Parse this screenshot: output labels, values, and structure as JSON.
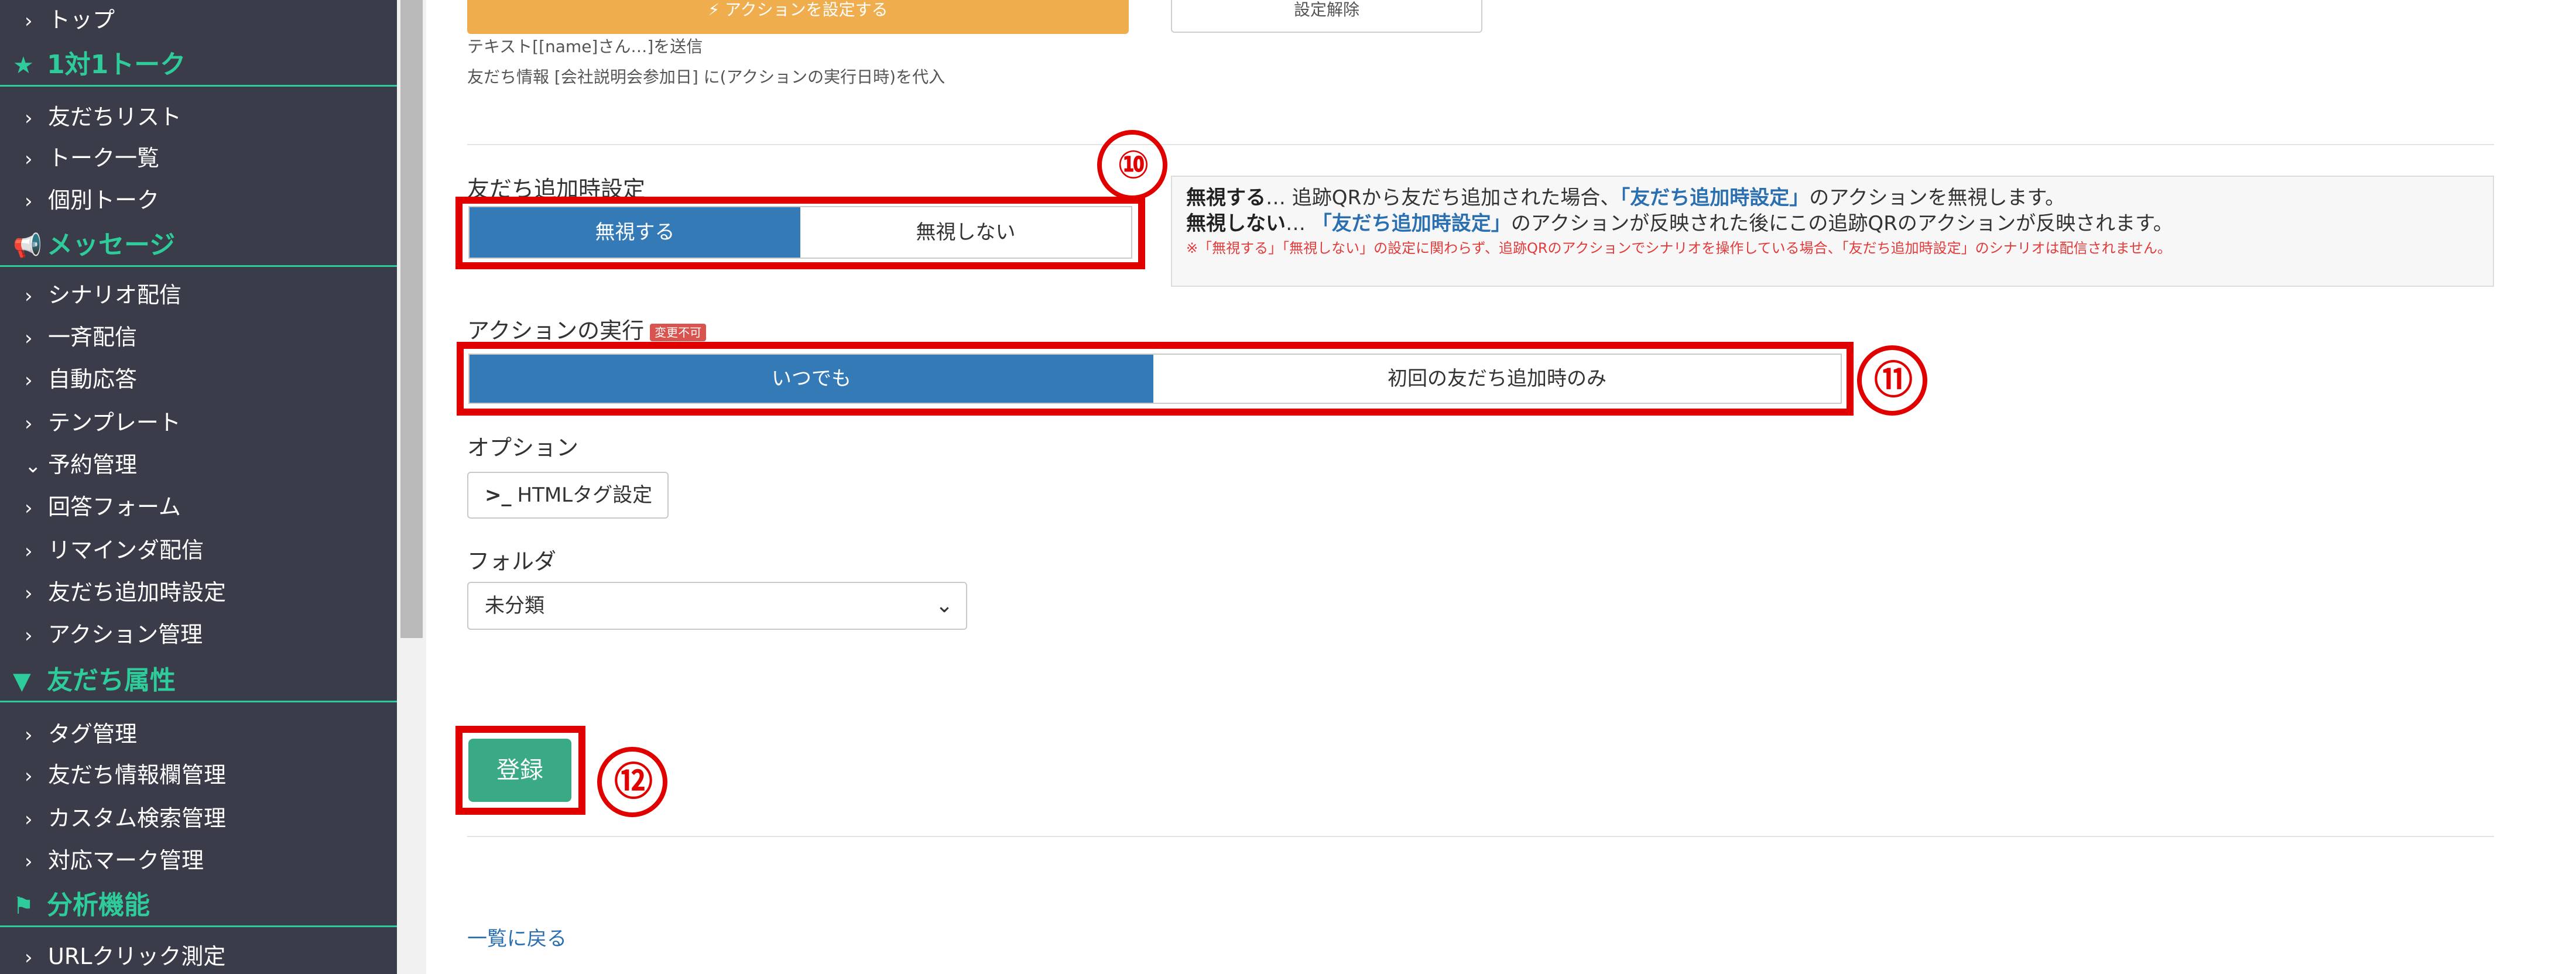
{
  "sidebar": {
    "items": [
      {
        "type": "item",
        "label": "トップ",
        "chev": "›"
      },
      {
        "type": "section",
        "label": "1対1トーク",
        "icon": "★"
      },
      {
        "type": "item",
        "label": "友だちリスト",
        "chev": "›"
      },
      {
        "type": "item",
        "label": "トーク一覧",
        "chev": "›"
      },
      {
        "type": "item",
        "label": "個別トーク",
        "chev": "›"
      },
      {
        "type": "section",
        "label": "メッセージ",
        "icon": "📢"
      },
      {
        "type": "item",
        "label": "シナリオ配信",
        "chev": "›"
      },
      {
        "type": "item",
        "label": "一斉配信",
        "chev": "›"
      },
      {
        "type": "item",
        "label": "自動応答",
        "chev": "›"
      },
      {
        "type": "item",
        "label": "テンプレート",
        "chev": "›"
      },
      {
        "type": "item",
        "label": "予約管理",
        "chev": "⌄"
      },
      {
        "type": "item",
        "label": "回答フォーム",
        "chev": "›"
      },
      {
        "type": "item",
        "label": "リマインダ配信",
        "chev": "›"
      },
      {
        "type": "item",
        "label": "友だち追加時設定",
        "chev": "›"
      },
      {
        "type": "item",
        "label": "アクション管理",
        "chev": "›"
      },
      {
        "type": "section",
        "label": "友だち属性",
        "icon": "▼"
      },
      {
        "type": "item",
        "label": "タグ管理",
        "chev": "›"
      },
      {
        "type": "item",
        "label": "友だち情報欄管理",
        "chev": "›"
      },
      {
        "type": "item",
        "label": "カスタム検索管理",
        "chev": "›"
      },
      {
        "type": "item",
        "label": "対応マーク管理",
        "chev": "›"
      },
      {
        "type": "section",
        "label": "分析機能",
        "icon": "⚑"
      },
      {
        "type": "item",
        "label": "URLクリック測定",
        "chev": "›"
      }
    ]
  },
  "top": {
    "action_button": "⚡ アクションを設定する",
    "unset_button": "設定解除",
    "note1": "テキスト[[name]さん…]を送信",
    "note2": "友だち情報 [会社説明会参加日] に(アクションの実行日時)を代入"
  },
  "friend_add": {
    "label": "友だち追加時設定",
    "option_ignore": "無視する",
    "option_not_ignore": "無視しない",
    "marker": "⑩"
  },
  "info": {
    "line1_bold": "無視する",
    "line1_rest_a": "… 追跡QRから友だち追加された場合、",
    "line1_hl": "「友だち追加時設定」",
    "line1_rest_b": "のアクションを無視します。",
    "line2_bold": "無視しない",
    "line2_rest_a": "… ",
    "line2_hl": "「友だち追加時設定」",
    "line2_rest_b": "のアクションが反映された後にこの追跡QRのアクションが反映されます。",
    "warning": "※「無視する」「無視しない」の設定に関わらず、追跡QRのアクションでシナリオを操作している場合、「友だち追加時設定」のシナリオは配信されません。"
  },
  "action_exec": {
    "label": "アクションの実行",
    "badge": "変更不可",
    "option_always": "いつでも",
    "option_first": "初回の友だち追加時のみ",
    "marker": "⑪"
  },
  "options": {
    "label": "オプション",
    "html_button": "HTMLタグ設定",
    "html_icon": ">_"
  },
  "folder": {
    "label": "フォルダ",
    "selected": "未分類"
  },
  "submit": {
    "label": "登録",
    "marker": "⑫"
  },
  "back_link": "一覧に戻る",
  "colors": {
    "sidebar_bg": "#3a3d49",
    "accent_green": "#2ecc9a",
    "primary_blue": "#337ab7",
    "warning_orange": "#f0ad4e",
    "highlight_red": "#e00000",
    "submit_green": "#3aaa86"
  }
}
